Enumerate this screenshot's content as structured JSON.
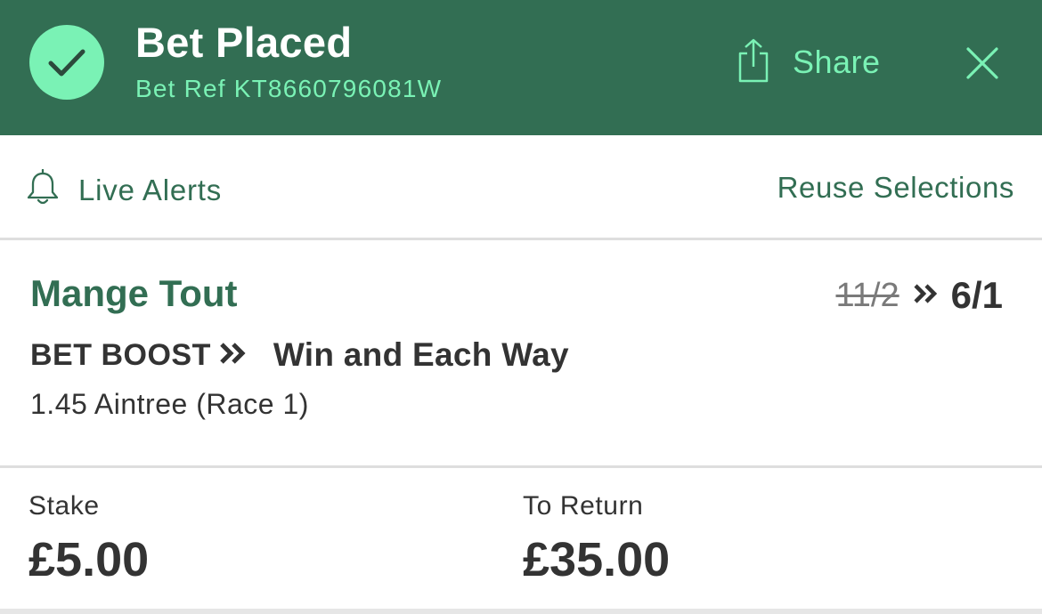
{
  "header": {
    "title": "Bet Placed",
    "bet_ref": "Bet Ref KT8660796081W",
    "share_label": "Share",
    "icons": [
      "check-icon",
      "share-icon",
      "close-icon"
    ],
    "background": "#326e53",
    "accent": "#7af2b5"
  },
  "alerts": {
    "live_alerts_label": "Live Alerts",
    "reuse_label": "Reuse Selections",
    "icon": "bell-icon"
  },
  "selection": {
    "name": "Mange Tout",
    "old_odds": "11/2",
    "new_odds": "6/1",
    "boost_label": "BET BOOST",
    "market": "Win and Each Way",
    "race": "1.45 Aintree (Race 1)"
  },
  "totals": {
    "stake_label": "Stake",
    "stake_value": "£5.00",
    "return_label": "To Return",
    "return_value": "£35.00"
  }
}
